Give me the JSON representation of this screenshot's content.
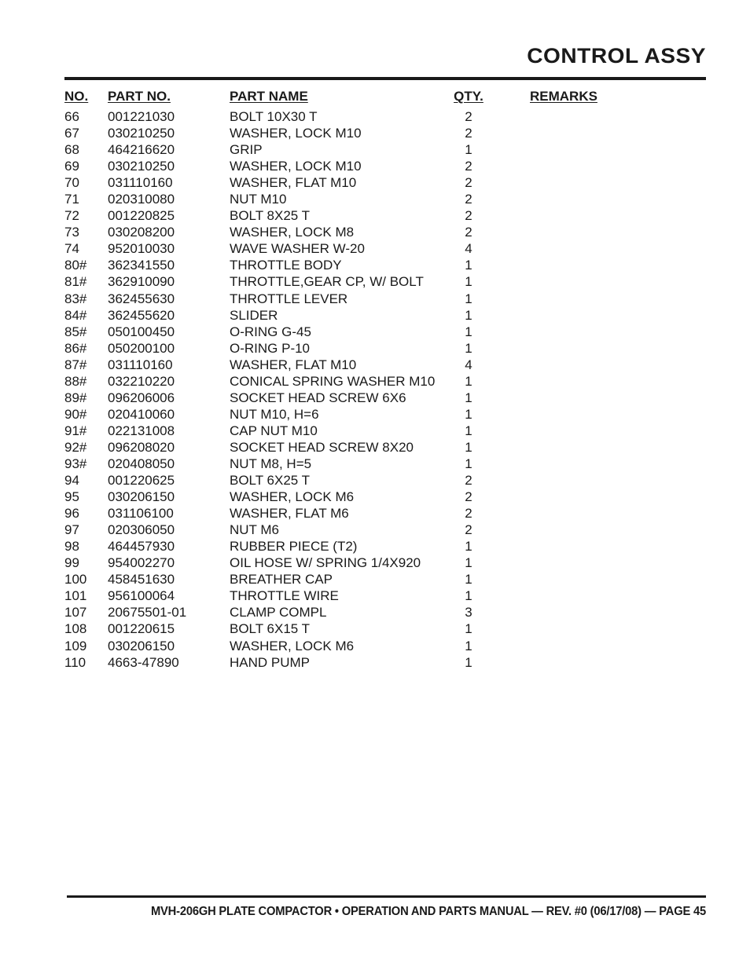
{
  "title": "CONTROL ASSY",
  "table": {
    "columns": {
      "no": "NO.",
      "part_no": "PART NO.",
      "part_name": "PART NAME",
      "qty": "QTY.",
      "remarks": "REMARKS"
    },
    "rows": [
      {
        "no": "66",
        "part_no": "001221030",
        "part_name": "BOLT 10X30 T",
        "qty": "2",
        "remarks": ""
      },
      {
        "no": "67",
        "part_no": "030210250",
        "part_name": "WASHER, LOCK M10",
        "qty": "2",
        "remarks": ""
      },
      {
        "no": "68",
        "part_no": "464216620",
        "part_name": "GRIP",
        "qty": "1",
        "remarks": ""
      },
      {
        "no": "69",
        "part_no": "030210250",
        "part_name": "WASHER, LOCK M10",
        "qty": "2",
        "remarks": ""
      },
      {
        "no": "70",
        "part_no": "031110160",
        "part_name": "WASHER, FLAT M10",
        "qty": "2",
        "remarks": ""
      },
      {
        "no": "71",
        "part_no": "020310080",
        "part_name": "NUT M10",
        "qty": "2",
        "remarks": ""
      },
      {
        "no": "72",
        "part_no": "001220825",
        "part_name": "BOLT 8X25 T",
        "qty": "2",
        "remarks": ""
      },
      {
        "no": "73",
        "part_no": "030208200",
        "part_name": "WASHER, LOCK M8",
        "qty": "2",
        "remarks": ""
      },
      {
        "no": "74",
        "part_no": "952010030",
        "part_name": "WAVE WASHER W-20",
        "qty": "4",
        "remarks": ""
      },
      {
        "no": "80#",
        "part_no": "362341550",
        "part_name": "THROTTLE BODY",
        "qty": "1",
        "remarks": ""
      },
      {
        "no": "81#",
        "part_no": "362910090",
        "part_name": "THROTTLE,GEAR CP, W/ BOLT",
        "qty": "1",
        "remarks": ""
      },
      {
        "no": "83#",
        "part_no": "362455630",
        "part_name": "THROTTLE LEVER",
        "qty": "1",
        "remarks": ""
      },
      {
        "no": "84#",
        "part_no": "362455620",
        "part_name": "SLIDER",
        "qty": "1",
        "remarks": ""
      },
      {
        "no": "85#",
        "part_no": "050100450",
        "part_name": "O-RING G-45",
        "qty": "1",
        "remarks": ""
      },
      {
        "no": "86#",
        "part_no": "050200100",
        "part_name": "O-RING P-10",
        "qty": "1",
        "remarks": ""
      },
      {
        "no": "87#",
        "part_no": "031110160",
        "part_name": "WASHER, FLAT M10",
        "qty": "4",
        "remarks": ""
      },
      {
        "no": "88#",
        "part_no": "032210220",
        "part_name": "CONICAL SPRING WASHER M10",
        "qty": "1",
        "remarks": ""
      },
      {
        "no": "89#",
        "part_no": "096206006",
        "part_name": "SOCKET HEAD SCREW 6X6",
        "qty": "1",
        "remarks": ""
      },
      {
        "no": "90#",
        "part_no": "020410060",
        "part_name": "NUT M10, H=6",
        "qty": "1",
        "remarks": ""
      },
      {
        "no": "91#",
        "part_no": "022131008",
        "part_name": "CAP NUT M10",
        "qty": "1",
        "remarks": ""
      },
      {
        "no": "92#",
        "part_no": "096208020",
        "part_name": "SOCKET HEAD SCREW 8X20",
        "qty": "1",
        "remarks": ""
      },
      {
        "no": "93#",
        "part_no": "020408050",
        "part_name": "NUT M8, H=5",
        "qty": "1",
        "remarks": ""
      },
      {
        "no": "94",
        "part_no": "001220625",
        "part_name": "BOLT 6X25 T",
        "qty": "2",
        "remarks": ""
      },
      {
        "no": "95",
        "part_no": "030206150",
        "part_name": "WASHER, LOCK M6",
        "qty": "2",
        "remarks": ""
      },
      {
        "no": "96",
        "part_no": "031106100",
        "part_name": "WASHER, FLAT M6",
        "qty": "2",
        "remarks": ""
      },
      {
        "no": "97",
        "part_no": "020306050",
        "part_name": "NUT M6",
        "qty": "2",
        "remarks": ""
      },
      {
        "no": "98",
        "part_no": "464457930",
        "part_name": "RUBBER PIECE (T2)",
        "qty": "1",
        "remarks": ""
      },
      {
        "no": "99",
        "part_no": "954002270",
        "part_name": "OIL HOSE W/ SPRING 1/4X920",
        "qty": "1",
        "remarks": ""
      },
      {
        "no": "100",
        "part_no": "458451630",
        "part_name": "BREATHER CAP",
        "qty": "1",
        "remarks": ""
      },
      {
        "no": "101",
        "part_no": "956100064",
        "part_name": "THROTTLE WIRE",
        "qty": "1",
        "remarks": ""
      },
      {
        "no": "107",
        "part_no": "20675501-01",
        "part_name": "CLAMP COMPL",
        "qty": "3",
        "remarks": ""
      },
      {
        "no": "108",
        "part_no": "001220615",
        "part_name": "BOLT 6X15 T",
        "qty": "1",
        "remarks": ""
      },
      {
        "no": "109",
        "part_no": "030206150",
        "part_name": "WASHER, LOCK M6",
        "qty": "1",
        "remarks": ""
      },
      {
        "no": "110",
        "part_no": "4663-47890",
        "part_name": "HAND PUMP",
        "qty": "1",
        "remarks": ""
      }
    ]
  },
  "footer": {
    "text": "MVH-206GH PLATE COMPACTOR • OPERATION AND PARTS MANUAL — REV. #0 (06/17/08) — PAGE 45"
  }
}
